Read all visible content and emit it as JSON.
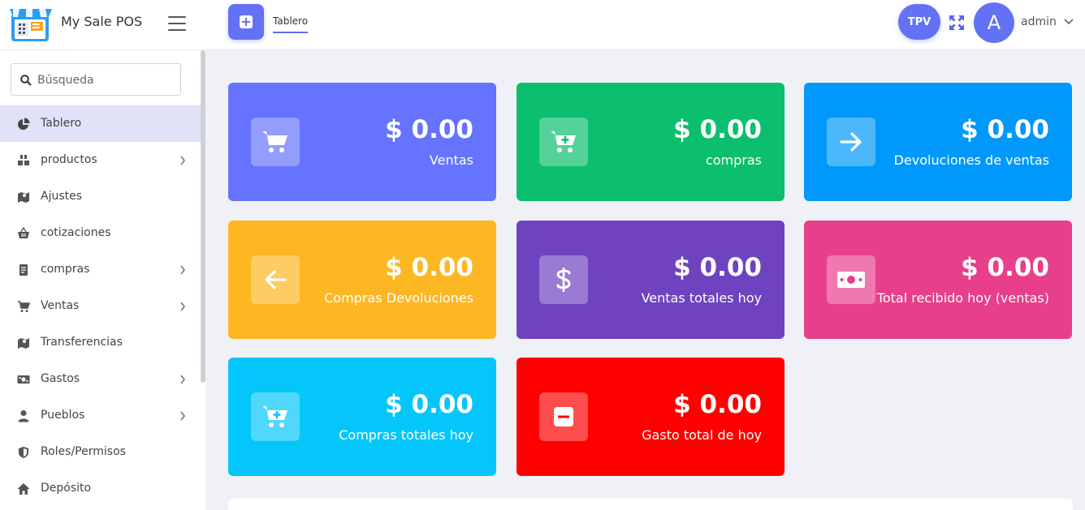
{
  "header": {
    "app_name": "My Sale POS",
    "tab_label": "Tablero",
    "tpv_label": "TPV",
    "avatar_letter": "A",
    "user_name": "admin"
  },
  "sidebar": {
    "search_placeholder": "Búsqueda",
    "items": [
      {
        "label": "Tablero",
        "icon": "pie-chart-icon",
        "active": true,
        "has_submenu": false
      },
      {
        "label": "productos",
        "icon": "boxes-icon",
        "active": false,
        "has_submenu": true
      },
      {
        "label": "Ajustes",
        "icon": "map-icon",
        "active": false,
        "has_submenu": false
      },
      {
        "label": "cotizaciones",
        "icon": "basket-icon",
        "active": false,
        "has_submenu": false
      },
      {
        "label": "compras",
        "icon": "receipt-icon",
        "active": false,
        "has_submenu": true
      },
      {
        "label": "Ventas",
        "icon": "cart-icon",
        "active": false,
        "has_submenu": true
      },
      {
        "label": "Transferencias",
        "icon": "map-icon",
        "active": false,
        "has_submenu": false
      },
      {
        "label": "Gastos",
        "icon": "money-icon",
        "active": false,
        "has_submenu": true
      },
      {
        "label": "Pueblos",
        "icon": "user-icon",
        "active": false,
        "has_submenu": true
      },
      {
        "label": "Roles/Permisos",
        "icon": "shield-icon",
        "active": false,
        "has_submenu": false
      },
      {
        "label": "Depósito",
        "icon": "home-icon",
        "active": false,
        "has_submenu": false
      }
    ]
  },
  "cards": [
    {
      "value": "$ 0.00",
      "label": "Ventas",
      "icon": "cart-icon",
      "color": "#6573fe"
    },
    {
      "value": "$ 0.00",
      "label": "compras",
      "icon": "cart-plus-icon",
      "color": "#0bbf6e"
    },
    {
      "value": "$ 0.00",
      "label": "Devoluciones de ventas",
      "icon": "arrow-right-icon",
      "color": "#0098fb"
    },
    {
      "value": "$ 0.00",
      "label": "Compras Devoluciones",
      "icon": "arrow-left-icon",
      "color": "#fdb723"
    },
    {
      "value": "$ 0.00",
      "label": "Ventas totales hoy",
      "icon": "dollar-icon",
      "color": "#6f43c0"
    },
    {
      "value": "$ 0.00",
      "label": "Total recibido hoy (ventas)",
      "icon": "money-icon",
      "color": "#e73f8b"
    },
    {
      "value": "$ 0.00",
      "label": "Compras totales hoy",
      "icon": "cart-plus-icon",
      "color": "#04c6fb"
    },
    {
      "value": "$ 0.00",
      "label": "Gasto total de hoy",
      "icon": "minus-icon",
      "color": "#fe0000"
    }
  ]
}
